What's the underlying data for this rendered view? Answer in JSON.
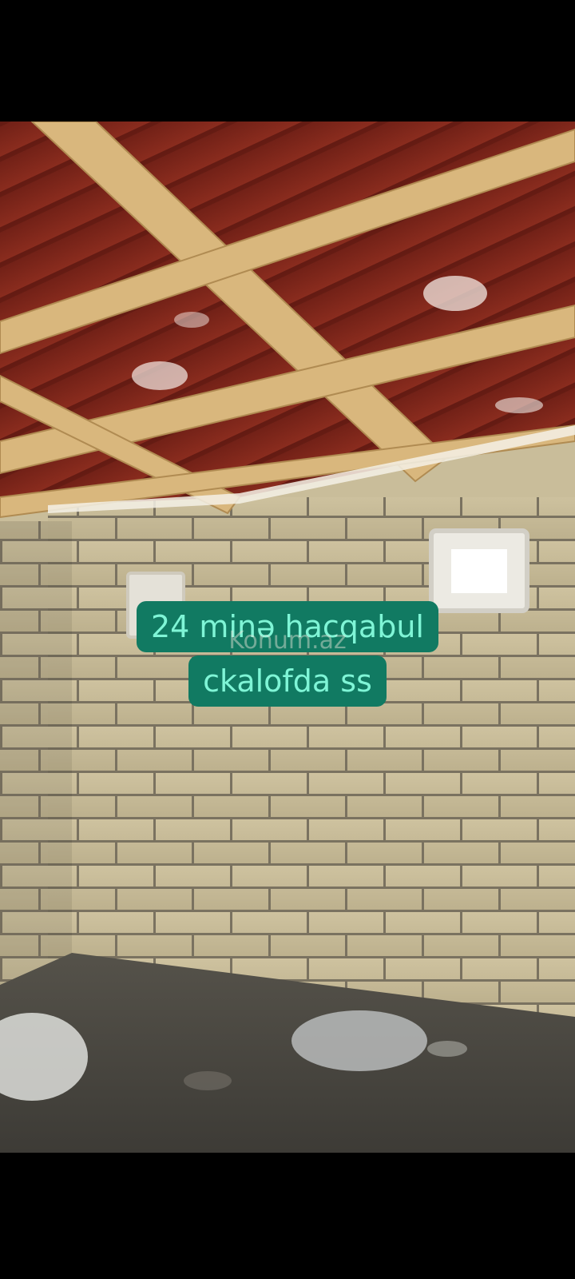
{
  "video": {
    "scene": "unfinished-room-interior",
    "background_color": "#000000",
    "caption": {
      "line1": "24 minə hacqabul",
      "line2": "ckalofda ss",
      "background_color": "#117a62",
      "text_color": "#7ff5d6"
    },
    "watermark": "Konum.az"
  }
}
